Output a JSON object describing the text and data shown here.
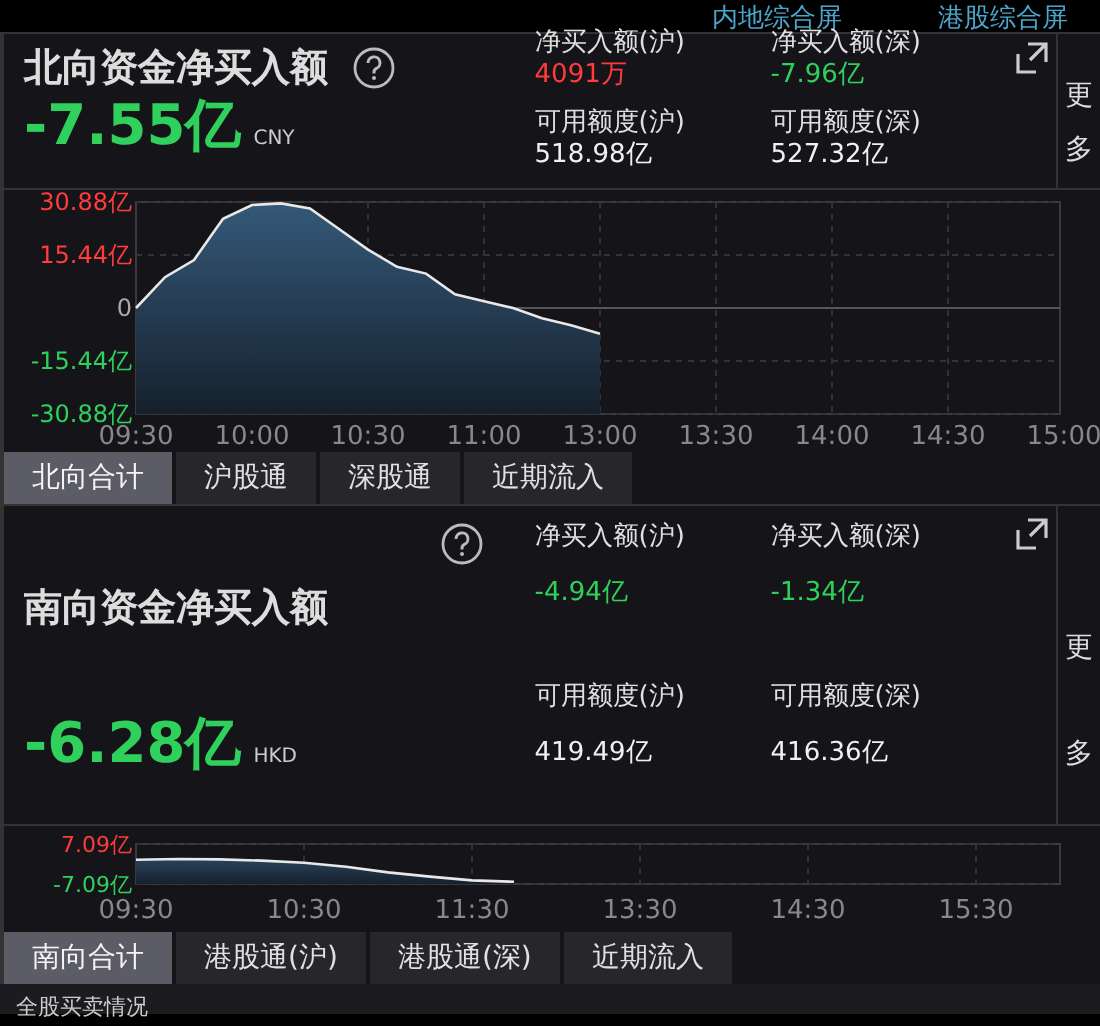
{
  "header_links": [
    {
      "label": "内地综合屏"
    },
    {
      "label": "港股综合屏"
    }
  ],
  "north": {
    "title": "北向资金净买入额",
    "value": {
      "text": "-7.55亿",
      "color": "#2fd05c"
    },
    "currency": "CNY",
    "more": "更多",
    "stats": [
      {
        "label": "净买入额(沪)",
        "value": "4091万",
        "color": "#ff3b3b"
      },
      {
        "label": "净买入额(深)",
        "value": "-7.96亿",
        "color": "#2fd05c"
      },
      {
        "label": "可用额度(沪)",
        "value": "518.98亿",
        "color": "#f0f0f0"
      },
      {
        "label": "可用额度(深)",
        "value": "527.32亿",
        "color": "#f0f0f0"
      }
    ],
    "chart_data": {
      "type": "line",
      "categories": [
        "09:30",
        null,
        null,
        null,
        "10:00",
        null,
        null,
        null,
        "10:30",
        null,
        null,
        null,
        "11:00",
        null,
        null,
        null,
        "13:00",
        null,
        null,
        null,
        "13:30",
        null,
        null,
        null,
        "14:00",
        null,
        null,
        null,
        "14:30",
        null,
        null,
        null,
        "15:00"
      ],
      "series": [
        {
          "color": "#e8e8e8",
          "values": [
            0,
            9,
            14,
            26,
            30,
            30.5,
            29,
            23,
            17,
            12,
            10,
            4,
            2,
            0,
            -3,
            -5,
            -7.5,
            null,
            null,
            null,
            null,
            null,
            null,
            null,
            null,
            null,
            null,
            null,
            null,
            null,
            null,
            null,
            null
          ]
        }
      ],
      "ylim": [
        -30.88,
        30.88
      ],
      "grid": true,
      "yticks": [
        {
          "value": 30.88,
          "label": "30.88亿"
        },
        {
          "value": 15.44,
          "label": "15.44亿"
        },
        {
          "value": 0,
          "label": "0"
        },
        {
          "value": -15.44,
          "label": "-15.44亿"
        },
        {
          "value": -30.88,
          "label": "-30.88亿"
        }
      ]
    },
    "tabs": [
      {
        "label": "北向合计",
        "selected": true
      },
      {
        "label": "沪股通",
        "selected": false
      },
      {
        "label": "深股通",
        "selected": false
      },
      {
        "label": "近期流入",
        "selected": false
      }
    ]
  },
  "south": {
    "title": "南向资金净买入额",
    "value": {
      "text": "-6.28亿",
      "color": "#2fd05c"
    },
    "currency": "HKD",
    "more": "更多",
    "stats": [
      {
        "label": "净买入额(沪)",
        "value": "-4.94亿",
        "color": "#2fd05c"
      },
      {
        "label": "净买入额(深)",
        "value": "-1.34亿",
        "color": "#2fd05c"
      },
      {
        "label": "可用额度(沪)",
        "value": "419.49亿",
        "color": "#f0f0f0"
      },
      {
        "label": "可用额度(深)",
        "value": "416.36亿",
        "color": "#f0f0f0"
      }
    ],
    "chart_data": {
      "type": "line",
      "categories": [
        "09:30",
        null,
        null,
        null,
        "10:30",
        null,
        null,
        null,
        "11:30",
        null,
        null,
        null,
        "13:30",
        null,
        null,
        null,
        "14:30",
        null,
        null,
        null,
        "15:30",
        null,
        null
      ],
      "series": [
        {
          "color": "#e8e8e8",
          "values": [
            1.5,
            1.8,
            1.6,
            1.2,
            0.4,
            -1,
            -3,
            -4.5,
            -5.8,
            -6.3,
            null,
            null,
            null,
            null,
            null,
            null,
            null,
            null,
            null,
            null,
            null,
            null,
            null
          ]
        }
      ],
      "ylim": [
        -7.09,
        7.09
      ],
      "grid": true,
      "yticks": [
        {
          "value": 7.09,
          "label": "7.09亿"
        },
        {
          "value": -7.09,
          "label": "-7.09亿"
        }
      ]
    },
    "tabs": [
      {
        "label": "南向合计",
        "selected": true
      },
      {
        "label": "港股通(沪)",
        "selected": false
      },
      {
        "label": "港股通(深)",
        "selected": false
      },
      {
        "label": "近期流入",
        "selected": false
      }
    ]
  },
  "footer": {
    "label": "全股买卖情况"
  }
}
